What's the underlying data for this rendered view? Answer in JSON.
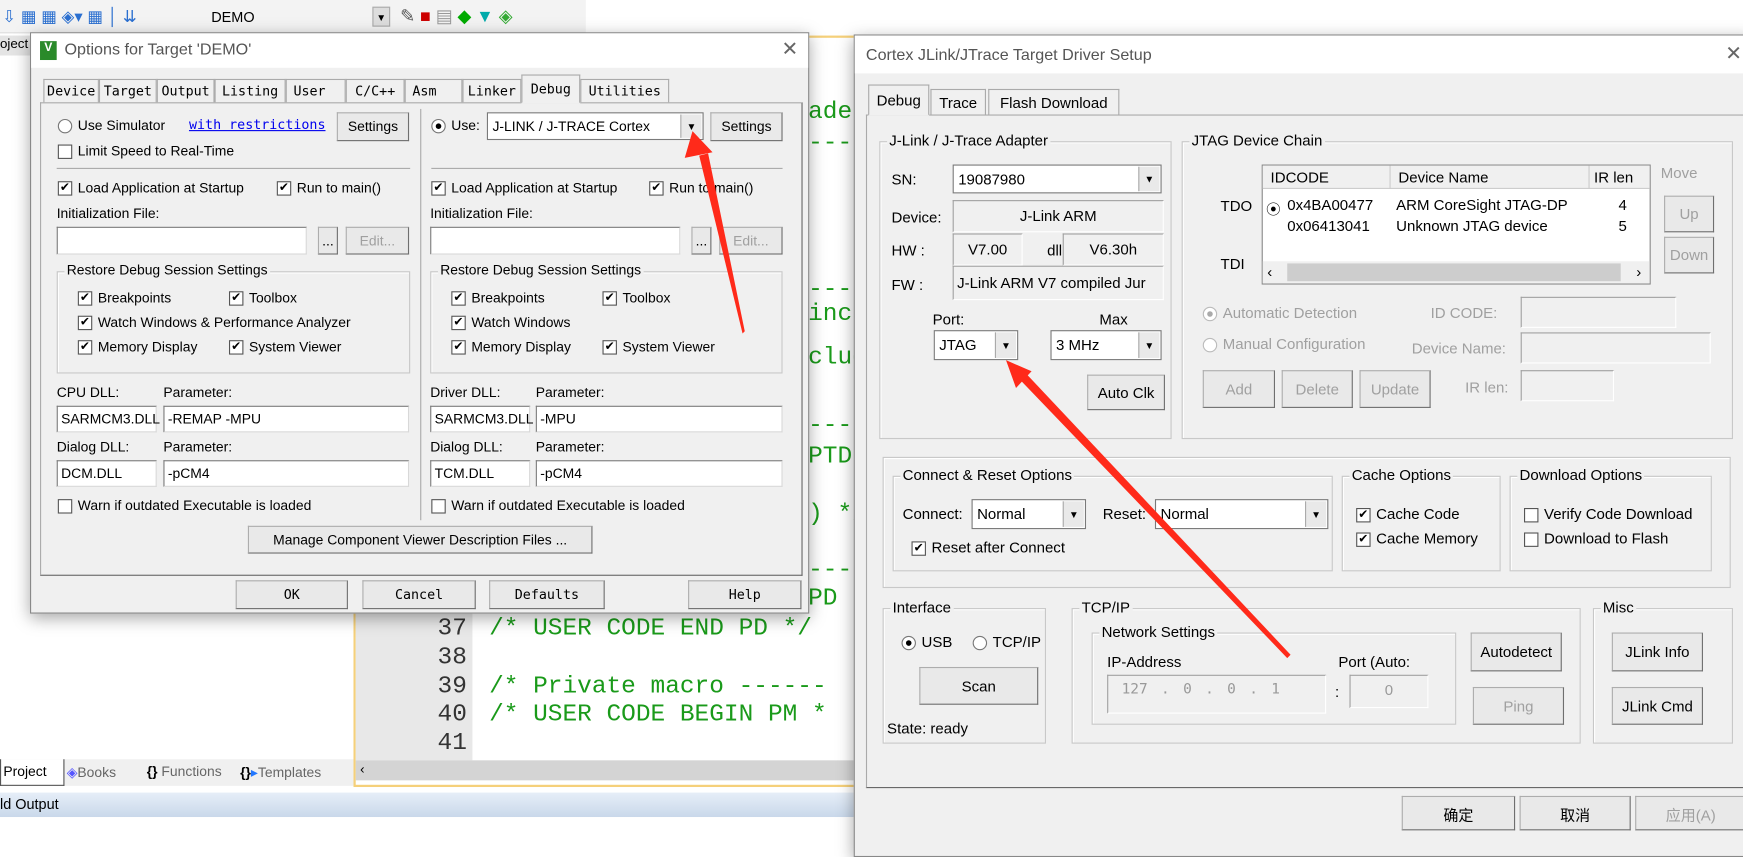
{
  "ide": {
    "toolbar": {
      "target": "DEMO"
    },
    "project_tab": "oject",
    "code_fragments": [
      "ader",
      "----",
      "----",
      "incl",
      "cluc",
      "----",
      "PTD",
      ") */",
      "----",
      "PD *"
    ],
    "line_numbers": [
      "37",
      "38",
      "39",
      "40",
      "41"
    ],
    "code_lines": [
      "/* USER CODE END PD */",
      "",
      "/* Private macro ------",
      "/* USER CODE BEGIN PM *",
      ""
    ],
    "bottom_tabs": [
      "Project",
      "Books",
      "Functions",
      "Templates"
    ],
    "output_title": "ld Output"
  },
  "options_dialog": {
    "title": "Options for Target 'DEMO'",
    "tabs": [
      "Device",
      "Target",
      "Output",
      "Listing",
      "User",
      "C/C++",
      "Asm",
      "Linker",
      "Debug",
      "Utilities"
    ],
    "active_tab": "Debug",
    "left": {
      "use_simulator": "Use Simulator",
      "restrictions_link": "with restrictions",
      "settings": "Settings",
      "limit_speed": "Limit Speed to Real-Time",
      "load_app": "Load Application at Startup",
      "run_to_main": "Run to main()",
      "init_file": "Initialization File:",
      "browse": "...",
      "edit": "Edit...",
      "restore_group": "Restore Debug Session Settings",
      "breakpoints": "Breakpoints",
      "toolbox": "Toolbox",
      "watch": "Watch Windows & Performance Analyzer",
      "memory": "Memory Display",
      "sysviewer": "System Viewer",
      "dll_label": "CPU DLL:",
      "param_label": "Parameter:",
      "dll": "SARMCM3.DLL",
      "param": "-REMAP -MPU",
      "dialog_dll_label": "Dialog DLL:",
      "dialog_param_label": "Parameter:",
      "dialog_dll": "DCM.DLL",
      "dialog_param": "-pCM4",
      "warn": "Warn if outdated Executable is loaded"
    },
    "right": {
      "use": "Use:",
      "driver": "J-LINK / J-TRACE Cortex",
      "settings": "Settings",
      "load_app": "Load Application at Startup",
      "run_to_main": "Run to main()",
      "init_file": "Initialization File:",
      "browse": "...",
      "edit": "Edit...",
      "restore_group": "Restore Debug Session Settings",
      "breakpoints": "Breakpoints",
      "toolbox": "Toolbox",
      "watch": "Watch Windows",
      "memory": "Memory Display",
      "sysviewer": "System Viewer",
      "dll_label": "Driver DLL:",
      "param_label": "Parameter:",
      "dll": "SARMCM3.DLL",
      "param": "-MPU",
      "dialog_dll_label": "Dialog DLL:",
      "dialog_param_label": "Parameter:",
      "dialog_dll": "TCM.DLL",
      "dialog_param": "-pCM4",
      "warn": "Warn if outdated Executable is loaded"
    },
    "manage_button": "Manage Component Viewer Description Files ...",
    "buttons": {
      "ok": "OK",
      "cancel": "Cancel",
      "defaults": "Defaults",
      "help": "Help"
    }
  },
  "jlink_dialog": {
    "title": "Cortex JLink/JTrace Target Driver Setup",
    "tabs": [
      "Debug",
      "Trace",
      "Flash Download"
    ],
    "active_tab": "Debug",
    "adapter": {
      "group": "J-Link / J-Trace Adapter",
      "sn_label": "SN:",
      "sn": "19087980",
      "device_label": "Device:",
      "device": "J-Link ARM",
      "hw_label": "HW :",
      "hw": "V7.00",
      "dll_label": "dll :",
      "dll": "V6.30h",
      "fw_label": "FW :",
      "fw": "J-Link ARM V7 compiled Jur",
      "port_label": "Port:",
      "port": "JTAG",
      "max_label": "Max",
      "max": "3 MHz",
      "auto_clk": "Auto Clk"
    },
    "chain": {
      "group": "JTAG Device Chain",
      "columns": [
        "IDCODE",
        "Device Name",
        "IR len"
      ],
      "rows": [
        {
          "idcode": "0x4BA00477",
          "name": "ARM CoreSight JTAG-DP",
          "irlen": "4"
        },
        {
          "idcode": "0x06413041",
          "name": "Unknown JTAG device",
          "irlen": "5"
        }
      ],
      "tdo": "TDO",
      "tdi": "TDI",
      "move": "Move",
      "up": "Up",
      "down": "Down",
      "auto_detect": "Automatic Detection",
      "manual_config": "Manual Configuration",
      "id_code_label": "ID CODE:",
      "device_name_label": "Device Name:",
      "ir_len_label": "IR len:",
      "add": "Add",
      "delete": "Delete",
      "update": "Update"
    },
    "connect": {
      "group": "Connect & Reset Options",
      "connect_label": "Connect:",
      "connect": "Normal",
      "reset_label": "Reset:",
      "reset": "Normal",
      "reset_after": "Reset after Connect"
    },
    "cache": {
      "group": "Cache Options",
      "code": "Cache Code",
      "memory": "Cache Memory"
    },
    "download": {
      "group": "Download Options",
      "verify": "Verify Code Download",
      "flash": "Download to Flash"
    },
    "interface": {
      "group": "Interface",
      "usb": "USB",
      "tcpip": "TCP/IP",
      "scan": "Scan",
      "state": "State: ready"
    },
    "tcpip": {
      "group": "TCP/IP",
      "network": "Network Settings",
      "ip_label": "IP-Address",
      "port_label": "Port (Auto:",
      "ip": [
        "127",
        "0",
        "0",
        "1"
      ],
      "port": "0",
      "autodetect": "Autodetect",
      "ping": "Ping"
    },
    "misc": {
      "group": "Misc",
      "info": "JLink Info",
      "cmd": "JLink Cmd"
    },
    "buttons": {
      "ok": "确定",
      "cancel": "取消",
      "apply": "应用(A)"
    }
  },
  "colors": {
    "annotation_arrow": "#ff2a1a",
    "code_comment": "#1a9a1a",
    "link": "#0000ee"
  }
}
